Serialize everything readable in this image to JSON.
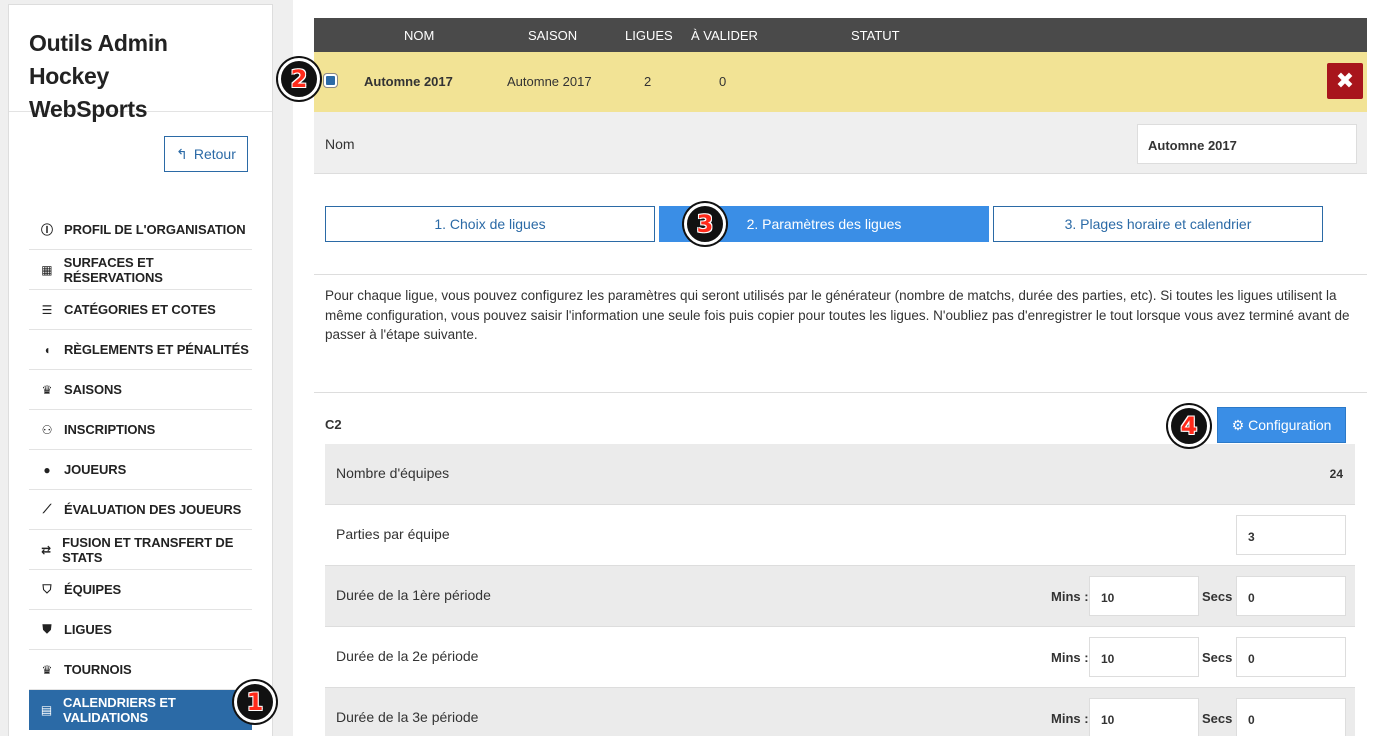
{
  "sidebar": {
    "brand_line1": "Outils Admin Hockey",
    "brand_line2": "WebSports",
    "back_label": "Retour",
    "items": [
      {
        "label": "Profil de l'organisation",
        "icon": "info-icon"
      },
      {
        "label": "Surfaces et réservations",
        "icon": "grid-icon"
      },
      {
        "label": "Catégories et cotes",
        "icon": "list-icon"
      },
      {
        "label": "Règlements et pénalités",
        "icon": "whistle-icon"
      },
      {
        "label": "Saisons",
        "icon": "trophy-icon"
      },
      {
        "label": "Inscriptions",
        "icon": "user-add-icon"
      },
      {
        "label": "Joueurs",
        "icon": "user-icon"
      },
      {
        "label": "Évaluation des joueurs",
        "icon": "chart-icon"
      },
      {
        "label": "Fusion et transfert de stats",
        "icon": "transfer-icon"
      },
      {
        "label": "Équipes",
        "icon": "shield-icon"
      },
      {
        "label": "Ligues",
        "icon": "shield-icon"
      },
      {
        "label": "Tournois",
        "icon": "trophy-icon"
      },
      {
        "label": "Calendriers et validations",
        "icon": "calendar-icon"
      }
    ]
  },
  "badges": {
    "b1": "1",
    "b2": "2",
    "b3": "3",
    "b4": "4"
  },
  "table": {
    "headers": {
      "nom": "NOM",
      "saison": "SAISON",
      "ligues": "LIGUES",
      "a_valider": "À VALIDER",
      "statut": "STATUT"
    },
    "row": {
      "nom": "Automne 2017",
      "saison": "Automne 2017",
      "ligues": "2",
      "a_valider": "0",
      "statut": ""
    }
  },
  "name_field": {
    "label": "Nom",
    "value": "Automne 2017"
  },
  "tabs": [
    "1. Choix de ligues",
    "2. Paramètres des ligues",
    "3. Plages horaire et calendrier"
  ],
  "intro": "Pour chaque ligue, vous pouvez configurez les paramètres qui seront utilisés par le générateur (nombre de matchs, durée des parties, etc). Si toutes les ligues utilisent la même configuration, vous pouvez saisir l'information une seule fois puis copier pour toutes les ligues. N'oubliez pas d'enregistrer le tout lorsque vous avez terminé avant de passer à l'étape suivante.",
  "league": {
    "name": "C2",
    "config_label": "Configuration",
    "teams_label": "Nombre d'équipes",
    "teams_value": "24",
    "games_label": "Parties par équipe",
    "games_value": "3",
    "mins_label": "Mins :",
    "secs_label": "Secs :",
    "periods": [
      {
        "label": "Durée de la 1ère période",
        "mins": "10",
        "secs": "0"
      },
      {
        "label": "Durée de la 2e période",
        "mins": "10",
        "secs": "0"
      },
      {
        "label": "Durée de la 3e période",
        "mins": "10",
        "secs": "0"
      }
    ]
  },
  "colors": {
    "accent": "#2b6aa6",
    "active_tab": "#3a8ee6",
    "highlight_row": "#f2e395",
    "danger": "#a8151c"
  }
}
